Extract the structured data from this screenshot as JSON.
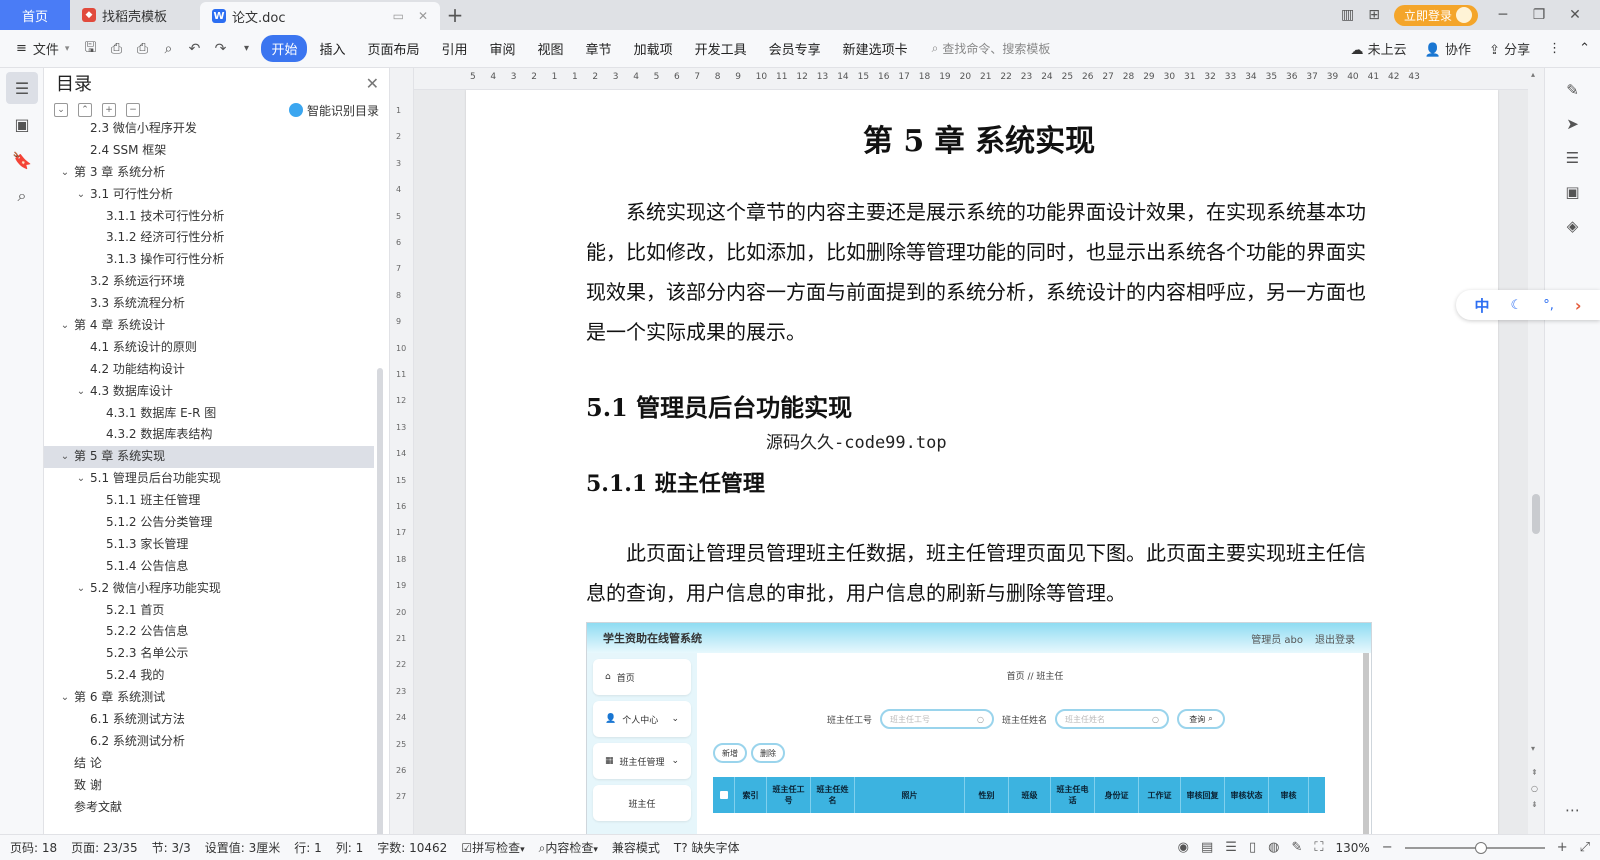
{
  "tabs": {
    "home": "首页",
    "template": "找稻壳模板",
    "document": "论文.doc",
    "login": "立即登录"
  },
  "ribbon": {
    "file": "文件",
    "tabs": [
      "开始",
      "插入",
      "页面布局",
      "引用",
      "审阅",
      "视图",
      "章节",
      "加载项",
      "开发工具",
      "会员专享",
      "新建选项卡"
    ],
    "search_placeholder": "查找命令、搜索模板",
    "cloud": "未上云",
    "collab": "协作",
    "share": "分享"
  },
  "toc": {
    "title": "目录",
    "smart": "智能识别目录",
    "items": [
      {
        "level": 2,
        "text": "2.3 微信小程序开发",
        "chev": false
      },
      {
        "level": 2,
        "text": "2.4 SSM 框架",
        "chev": false
      },
      {
        "level": 1,
        "text": "第 3 章  系统分析",
        "chev": true
      },
      {
        "level": 2,
        "text": "3.1 可行性分析",
        "chev": true
      },
      {
        "level": 3,
        "text": "3.1.1 技术可行性分析",
        "chev": false
      },
      {
        "level": 3,
        "text": "3.1.2 经济可行性分析",
        "chev": false
      },
      {
        "level": 3,
        "text": "3.1.3 操作可行性分析",
        "chev": false
      },
      {
        "level": 2,
        "text": "3.2 系统运行环境",
        "chev": false
      },
      {
        "level": 2,
        "text": "3.3 系统流程分析",
        "chev": false
      },
      {
        "level": 1,
        "text": "第 4 章  系统设计",
        "chev": true
      },
      {
        "level": 2,
        "text": "4.1  系统设计的原则",
        "chev": false
      },
      {
        "level": 2,
        "text": "4.2  功能结构设计",
        "chev": false
      },
      {
        "level": 2,
        "text": "4.3  数据库设计",
        "chev": true
      },
      {
        "level": 3,
        "text": "4.3.1  数据库 E-R 图",
        "chev": false
      },
      {
        "level": 3,
        "text": "4.3.2  数据库表结构",
        "chev": false
      },
      {
        "level": 1,
        "text": "第 5 章  系统实现",
        "chev": true,
        "selected": true
      },
      {
        "level": 2,
        "text": "5.1 管理员后台功能实现",
        "chev": true
      },
      {
        "level": 3,
        "text": "5.1.1  班主任管理",
        "chev": false
      },
      {
        "level": 3,
        "text": "5.1.2  公告分类管理",
        "chev": false
      },
      {
        "level": 3,
        "text": "5.1.3  家长管理",
        "chev": false
      },
      {
        "level": 3,
        "text": "5.1.4  公告信息",
        "chev": false
      },
      {
        "level": 2,
        "text": "5.2  微信小程序功能实现",
        "chev": true
      },
      {
        "level": 3,
        "text": "5.2.1  首页",
        "chev": false
      },
      {
        "level": 3,
        "text": "5.2.2  公告信息",
        "chev": false
      },
      {
        "level": 3,
        "text": "5.2.3  名单公示",
        "chev": false
      },
      {
        "level": 3,
        "text": "5.2.4  我的",
        "chev": false
      },
      {
        "level": 1,
        "text": "第 6 章  系统测试",
        "chev": true
      },
      {
        "level": 2,
        "text": "6.1 系统测试方法",
        "chev": false
      },
      {
        "level": 2,
        "text": "6.2  系统测试分析",
        "chev": false
      },
      {
        "level": 1,
        "text": "结    论",
        "chev": false
      },
      {
        "level": 1,
        "text": "致    谢",
        "chev": false
      },
      {
        "level": 1,
        "text": "参考文献",
        "chev": false
      }
    ]
  },
  "ruler": {
    "h": [
      "5",
      "4",
      "3",
      "2",
      "1",
      "1",
      "2",
      "3",
      "4",
      "5",
      "6",
      "7",
      "8",
      "9",
      "10",
      "11",
      "12",
      "13",
      "14",
      "15",
      "16",
      "17",
      "18",
      "19",
      "20",
      "21",
      "22",
      "23",
      "24",
      "25",
      "26",
      "27",
      "28",
      "29",
      "30",
      "31",
      "32",
      "33",
      "34",
      "35",
      "36",
      "37",
      "39",
      "40",
      "41",
      "42",
      "43"
    ],
    "v": [
      "1",
      "2",
      "3",
      "4",
      "5",
      "6",
      "7",
      "8",
      "9",
      "10",
      "11",
      "12",
      "13",
      "14",
      "15",
      "16",
      "17",
      "18",
      "19",
      "20",
      "21",
      "22",
      "23",
      "24",
      "25",
      "26",
      "27"
    ]
  },
  "document": {
    "chapter": "第 5 章  系统实现",
    "para1": "系统实现这个章节的内容主要还是展示系统的功能界面设计效果，在实现系统基本功能，比如修改，比如添加，比如删除等管理功能的同时，也显示出系统各个功能的界面实现效果，该部分内容一方面与前面提到的系统分析，系统设计的内容相呼应，另一方面也是一个实际成果的展示。",
    "h51": "5.1 管理员后台功能实现",
    "watermark": "源码久久-code99.top",
    "h511": "5.1.1  班主任管理",
    "para2": "此页面让管理员管理班主任数据，班主任管理页面见下图。此页面主要实现班主任信息的查询，用户信息的审批，用户信息的刷新与删除等管理。"
  },
  "screenshot": {
    "title": "学生资助在线管系统",
    "user": "管理员 abo",
    "logout": "退出登录",
    "side": [
      "首页",
      "个人中心",
      "班主任管理",
      "班主任"
    ],
    "crumb": "首页 // 班主任",
    "search_label1": "班主任工号",
    "search_ph1": "班主任工号",
    "search_label2": "班主任姓名",
    "search_ph2": "班主任姓名",
    "query": "查询",
    "add": "新增",
    "del": "删除",
    "columns": [
      "索引",
      "班主任工号",
      "班主任姓名",
      "照片",
      "性别",
      "班级",
      "班主任电话",
      "身份证",
      "工作证",
      "审核回复",
      "审核状态",
      "审核"
    ]
  },
  "ime": {
    "lang": "中"
  },
  "status": {
    "page_code": "页码: 18",
    "pages": "页面: 23/35",
    "section": "节: 3/3",
    "setting": "设置值: 3厘米",
    "row": "行: 1",
    "col": "列: 1",
    "words": "字数: 10462",
    "spell": "拼写检查",
    "content_check": "内容检查",
    "compat": "兼容模式",
    "missing_font": "缺失字体",
    "zoom": "130%"
  }
}
